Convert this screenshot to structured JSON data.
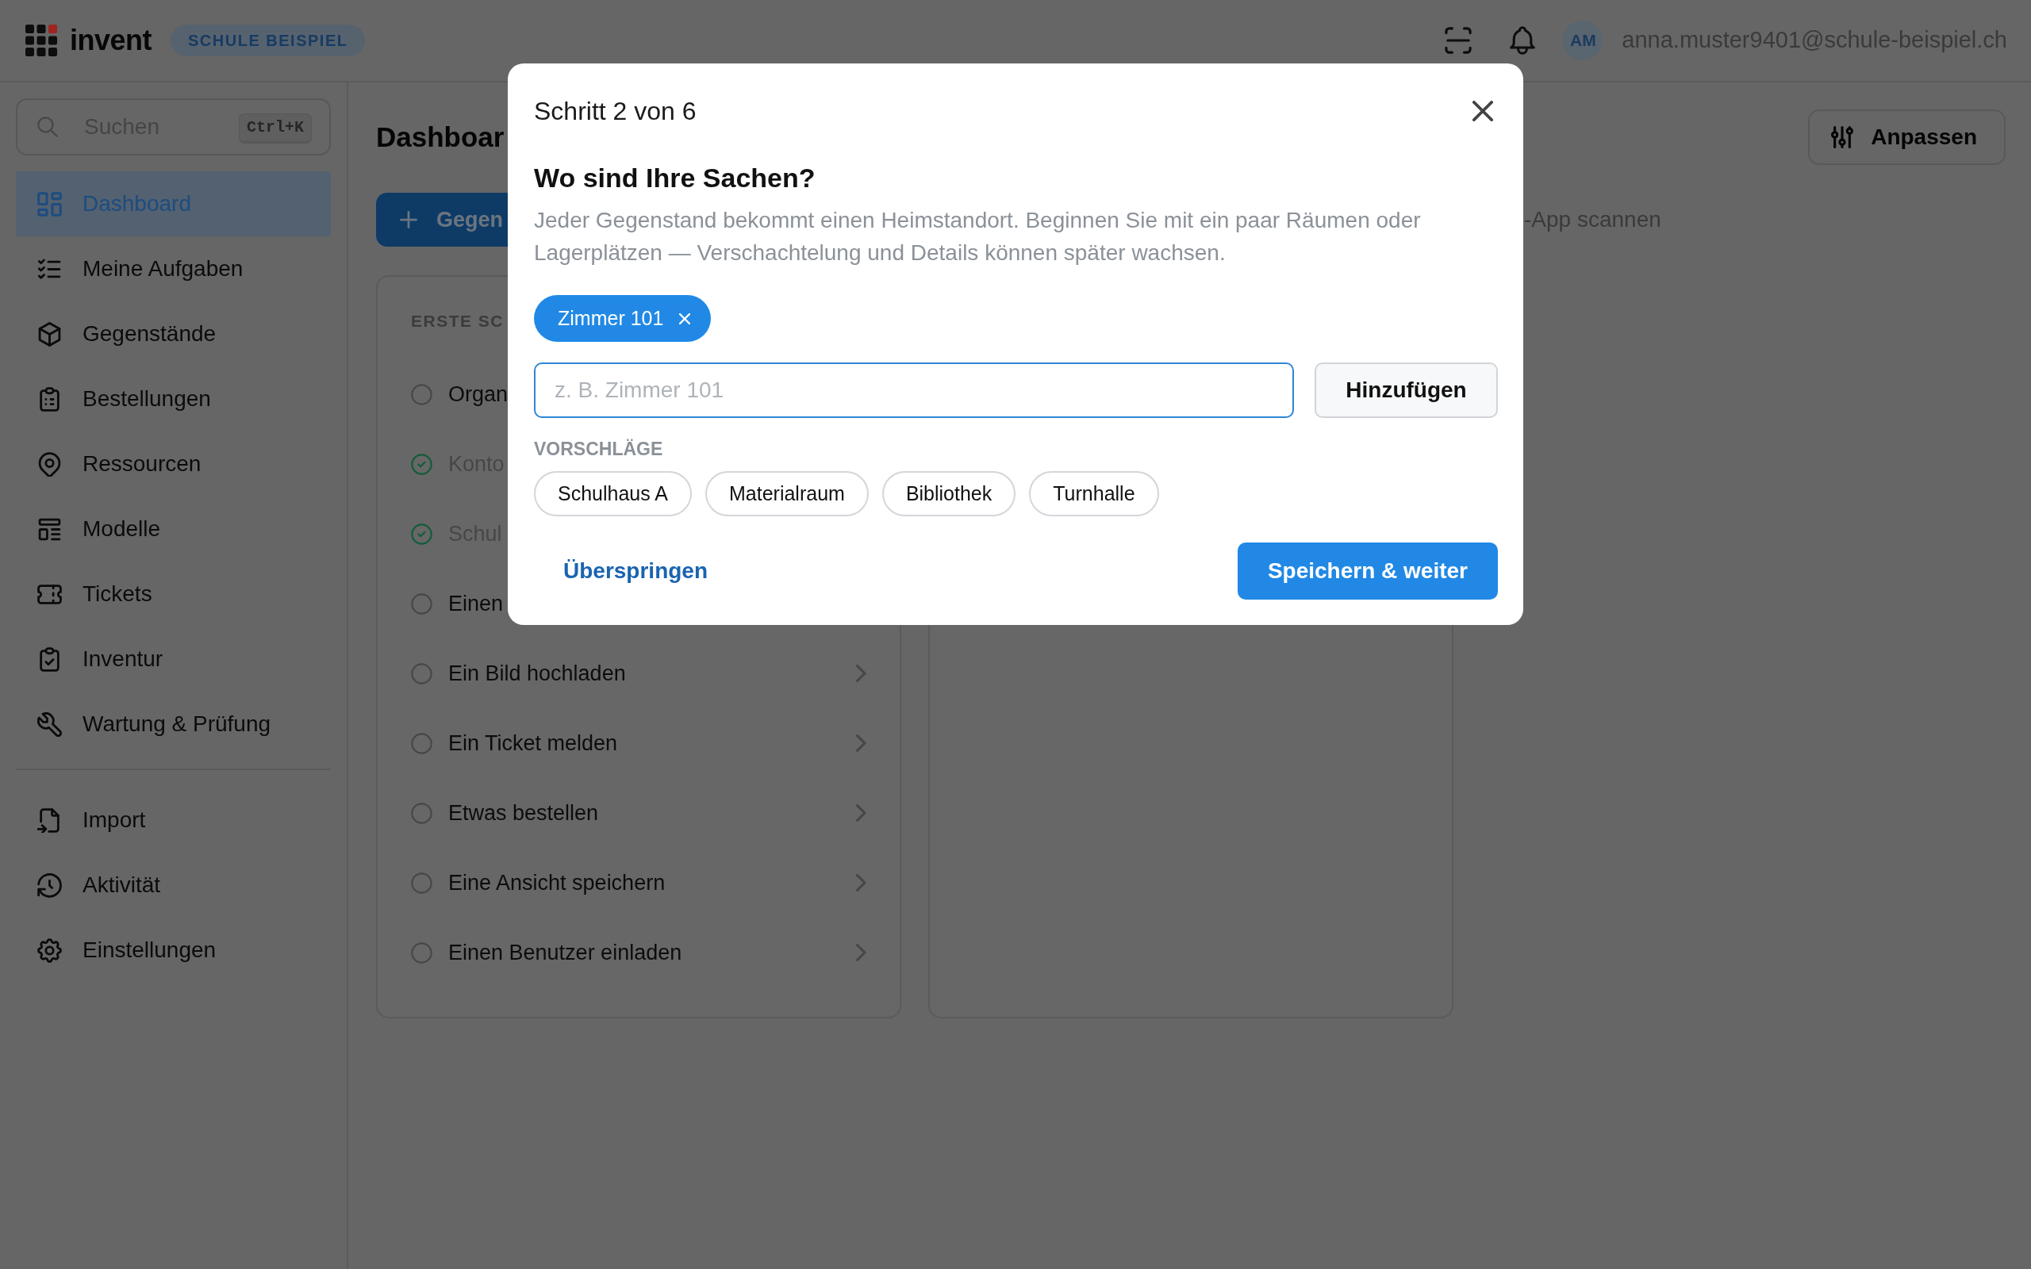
{
  "topbar": {
    "app_name": "invent",
    "organization": "SCHULE BEISPIEL",
    "avatar_initials": "AM",
    "user_email": "anna.muster9401@schule-beispiel.ch"
  },
  "sidebar": {
    "search": {
      "placeholder": "Suchen",
      "shortcut": "Ctrl+K"
    },
    "sections": [
      {
        "items": [
          {
            "label": "Dashboard",
            "selected": true
          },
          {
            "label": "Meine Aufgaben",
            "selected": false
          },
          {
            "label": "Gegenstände",
            "selected": false
          },
          {
            "label": "Bestellungen",
            "selected": false
          },
          {
            "label": "Ressourcen",
            "selected": false
          },
          {
            "label": "Modelle",
            "selected": false
          },
          {
            "label": "Tickets",
            "selected": false
          },
          {
            "label": "Inventur",
            "selected": false
          },
          {
            "label": "Wartung & Prüfung",
            "selected": false
          }
        ]
      },
      {
        "items": [
          {
            "label": "Import",
            "selected": false
          },
          {
            "label": "Aktivität",
            "selected": false
          },
          {
            "label": "Einstellungen",
            "selected": false
          }
        ]
      }
    ]
  },
  "main": {
    "heading": "Dashboar",
    "customize_button": "Anpassen",
    "new_button": "Gegen",
    "hint": "-App scannen",
    "checklist": {
      "title": "ERSTE SC",
      "items": [
        {
          "label": "Organ",
          "done": false,
          "kind": "covered"
        },
        {
          "label": "Konto",
          "done": true,
          "kind": "covered"
        },
        {
          "label": "Schul",
          "done": true,
          "kind": "covered"
        },
        {
          "label": "Einen",
          "done": false,
          "kind": "covered"
        },
        {
          "label": "Ein Bild hochladen",
          "done": false,
          "kind": "link"
        },
        {
          "label": "Ein Ticket melden",
          "done": false,
          "kind": "link"
        },
        {
          "label": "Etwas bestellen",
          "done": false,
          "kind": "link"
        },
        {
          "label": "Eine Ansicht speichern",
          "done": false,
          "kind": "link"
        },
        {
          "label": "Einen Benutzer einladen",
          "done": false,
          "kind": "link"
        }
      ]
    }
  },
  "dialog": {
    "step": "Schritt 2 von 6",
    "title": "Wo sind Ihre Sachen?",
    "description": "Jeder Gegenstand bekommt einen Heimstandort. Beginnen Sie mit ein paar Räumen oder Lagerplätzen — Verschachtelung und Details können später wachsen.",
    "tags": [
      {
        "label": "Zimmer 101"
      }
    ],
    "input": {
      "placeholder": "z. B. Zimmer 101"
    },
    "add_button": "Hinzufügen",
    "suggestions_label": "VORSCHLÄGE",
    "suggestions": [
      "Schulhaus A",
      "Materialraum",
      "Bibliothek",
      "Turnhalle"
    ],
    "skip_link": "Überspringen",
    "submit_button": "Speichern & weiter"
  }
}
